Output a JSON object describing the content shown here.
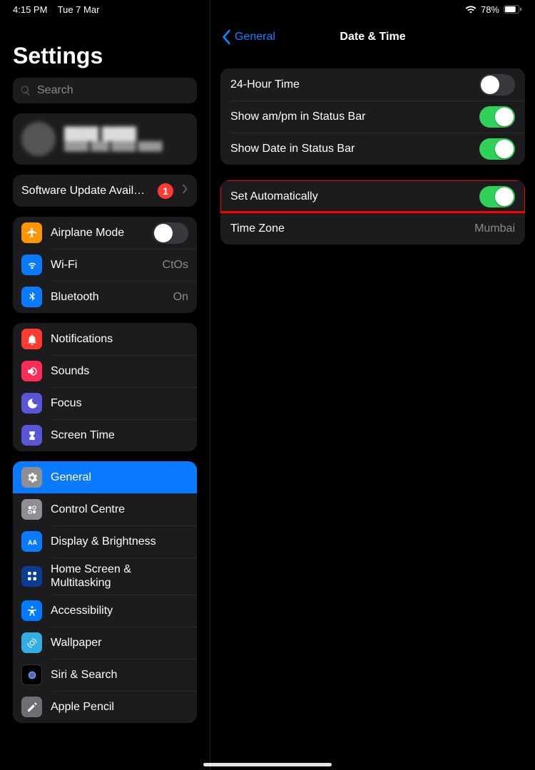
{
  "status": {
    "time": "4:15 PM",
    "date": "Tue 7 Mar",
    "battery": "78%"
  },
  "sidebar": {
    "title": "Settings",
    "search_placeholder": "Search",
    "software_update": {
      "label": "Software Update Avail…",
      "badge": "1"
    },
    "airplane": {
      "label": "Airplane Mode"
    },
    "wifi": {
      "label": "Wi-Fi",
      "value": "CtOs"
    },
    "bluetooth": {
      "label": "Bluetooth",
      "value": "On"
    },
    "notifications": {
      "label": "Notifications"
    },
    "sounds": {
      "label": "Sounds"
    },
    "focus": {
      "label": "Focus"
    },
    "screentime": {
      "label": "Screen Time"
    },
    "general": {
      "label": "General"
    },
    "control": {
      "label": "Control Centre"
    },
    "display": {
      "label": "Display & Brightness"
    },
    "homescreen": {
      "label": "Home Screen & Multitasking"
    },
    "accessibility": {
      "label": "Accessibility"
    },
    "wallpaper": {
      "label": "Wallpaper"
    },
    "siri": {
      "label": "Siri & Search"
    },
    "pencil": {
      "label": "Apple Pencil"
    }
  },
  "detail": {
    "back": "General",
    "title": "Date & Time",
    "rows": {
      "h24": {
        "label": "24-Hour Time"
      },
      "ampm": {
        "label": "Show am/pm in Status Bar"
      },
      "date": {
        "label": "Show Date in Status Bar"
      },
      "auto": {
        "label": "Set Automatically"
      },
      "tz": {
        "label": "Time Zone",
        "value": "Mumbai"
      }
    }
  }
}
